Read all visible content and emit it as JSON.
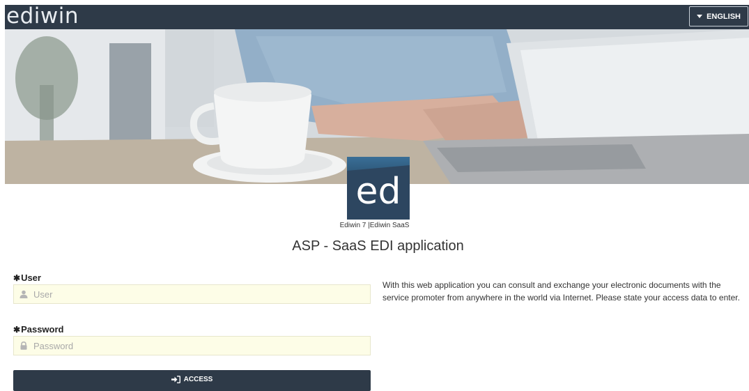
{
  "header": {
    "brand": "ediwin",
    "language_label": "ENGLISH"
  },
  "logo": {
    "text": "ed",
    "caption": "Ediwin 7 |Ediwin SaaS"
  },
  "main": {
    "title": "ASP - SaaS EDI application",
    "description": "With this web application you can consult and exchange your electronic documents with the service promoter from anywhere in the world via Internet. Please state your access data to enter."
  },
  "form": {
    "required_mark": "✱",
    "user_label": "User",
    "user_placeholder": "User",
    "user_value": "",
    "password_label": "Password",
    "password_placeholder": "Password",
    "password_value": "",
    "access_label": "ACCESS"
  },
  "colors": {
    "header_bg": "#2e3a48",
    "input_bg": "#fdfde7",
    "logo_bg": "#2d4660"
  },
  "icons": {
    "language": "caret-down-icon",
    "user": "user-icon",
    "password": "lock-icon",
    "access": "sign-in-icon"
  }
}
